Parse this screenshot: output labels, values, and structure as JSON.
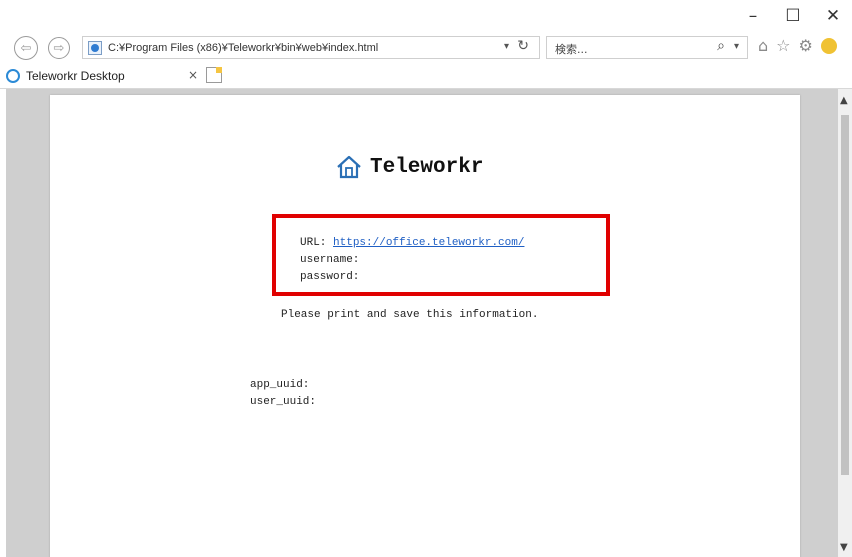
{
  "window": {
    "minimize_glyph": "–",
    "maximize_glyph": "☐",
    "close_glyph": "✕"
  },
  "toolbar": {
    "back_icon": "back-arrow-icon",
    "forward_icon": "forward-arrow-icon",
    "address": "C:¥Program Files (x86)¥Teleworkr¥bin¥web¥index.html",
    "refresh_glyph": "↻",
    "search_placeholder": "検索...",
    "search_glyph": "⌕",
    "home_glyph": "⌂",
    "favorites_glyph": "☆",
    "tools_glyph": "⚙"
  },
  "tabs": [
    {
      "title": "Teleworkr Desktop",
      "close_glyph": "×"
    }
  ],
  "page": {
    "brand": "Teleworkr",
    "url_label": "URL:",
    "url_link": "https://office.teleworkr.com/",
    "username_label": "username:",
    "password_label": "password:",
    "notice": "Please print and save this information.",
    "app_uuid_label": "app_uuid:",
    "user_uuid_label": "user_uuid:"
  },
  "colors": {
    "highlight_box": "#e00000",
    "link": "#1f5fc4",
    "page_background": "#cfcfcf"
  }
}
